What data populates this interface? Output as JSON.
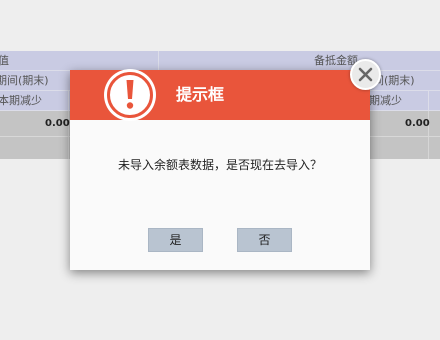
{
  "background_table": {
    "header_left": "值",
    "header_right": "备抵金额",
    "row2_left": "期间(期末)",
    "row2_right": "期间(期末)",
    "row3_left": "本期减少",
    "row3_right": "本期减少",
    "value_left": "0.00",
    "value_right": "0.00"
  },
  "dialog": {
    "title": "提示框",
    "message": "未导入余额表数据，是否现在去导入？",
    "yes_label": "是",
    "no_label": "否",
    "icon": "exclamation-circle-icon",
    "close_icon": "close-icon",
    "header_color": "#e9553b",
    "button_color": "#b9c4d1"
  }
}
